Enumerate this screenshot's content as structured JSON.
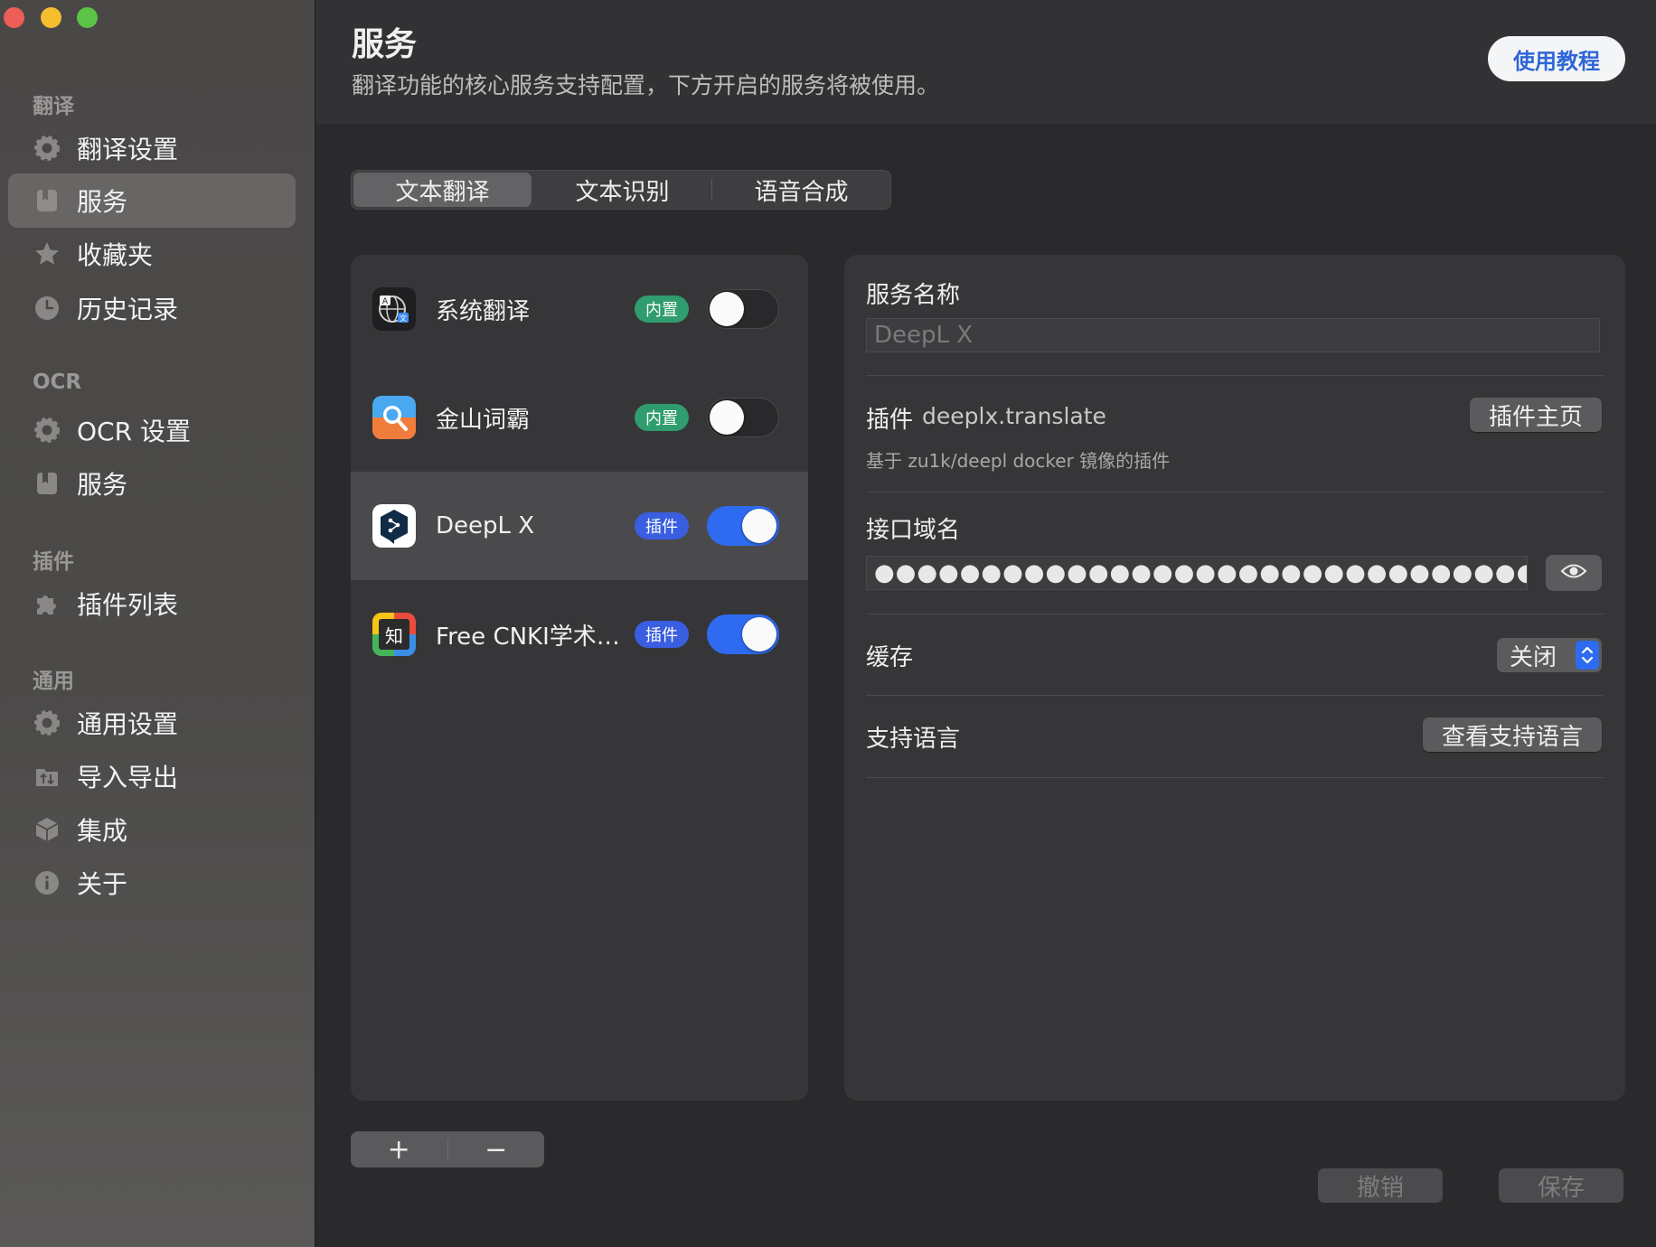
{
  "window": {
    "controls": [
      "close",
      "minimize",
      "zoom"
    ]
  },
  "sidebar": {
    "sections": [
      {
        "title": "翻译",
        "items": [
          {
            "label": "翻译设置",
            "icon": "gear-icon",
            "active": false
          },
          {
            "label": "服务",
            "icon": "bookmark-icon",
            "active": true
          },
          {
            "label": "收藏夹",
            "icon": "star-icon",
            "active": false
          },
          {
            "label": "历史记录",
            "icon": "clock-icon",
            "active": false
          }
        ]
      },
      {
        "title": "OCR",
        "items": [
          {
            "label": "OCR 设置",
            "icon": "gear-icon",
            "active": false
          },
          {
            "label": "服务",
            "icon": "bookmark-icon",
            "active": false
          }
        ]
      },
      {
        "title": "插件",
        "items": [
          {
            "label": "插件列表",
            "icon": "puzzle-icon",
            "active": false
          }
        ]
      },
      {
        "title": "通用",
        "items": [
          {
            "label": "通用设置",
            "icon": "gear-icon",
            "active": false
          },
          {
            "label": "导入导出",
            "icon": "folder-transfer-icon",
            "active": false
          },
          {
            "label": "集成",
            "icon": "cube-icon",
            "active": false
          },
          {
            "label": "关于",
            "icon": "info-icon",
            "active": false
          }
        ]
      }
    ]
  },
  "header": {
    "title": "服务",
    "subtitle": "翻译功能的核心服务支持配置，下方开启的服务将被使用。",
    "tutorial_label": "使用教程"
  },
  "tabs": [
    {
      "label": "文本翻译",
      "active": true
    },
    {
      "label": "文本识别",
      "active": false
    },
    {
      "label": "语音合成",
      "active": false
    }
  ],
  "services": [
    {
      "name": "系统翻译",
      "badge": "内置",
      "badge_type": "builtin",
      "enabled": false,
      "selected": false,
      "icon": "system-translate-icon"
    },
    {
      "name": "金山词霸",
      "badge": "内置",
      "badge_type": "builtin",
      "enabled": false,
      "selected": false,
      "icon": "iciba-icon"
    },
    {
      "name": "DeepL X",
      "badge": "插件",
      "badge_type": "plugin",
      "enabled": true,
      "selected": true,
      "icon": "deepl-icon"
    },
    {
      "name": "Free CNKI学术…",
      "badge": "插件",
      "badge_type": "plugin",
      "enabled": true,
      "selected": false,
      "icon": "cnki-icon"
    }
  ],
  "list_controls": {
    "add": "+",
    "remove": "−"
  },
  "detail": {
    "service_name_label": "服务名称",
    "service_name_placeholder": "DeepL X",
    "plugin_label": "插件",
    "plugin_id": "deeplx.translate",
    "plugin_homepage_button": "插件主页",
    "plugin_description": "基于 zu1k/deepl docker 镜像的插件",
    "api_domain_label": "接口域名",
    "api_domain_masked": "●●●●●●●●●●●●●●●●●●●●●●●●●●●●●●●●●●●●●●",
    "cache_label": "缓存",
    "cache_value": "关闭",
    "languages_label": "支持语言",
    "languages_button": "查看支持语言"
  },
  "footer": {
    "cancel_label": "撤销",
    "save_label": "保存"
  },
  "colors": {
    "accent": "#2f6bf0",
    "builtin_badge": "#2f9d6d",
    "plugin_badge": "#3a5ee0",
    "close": "#ee5d58",
    "minimize": "#f5be2f",
    "zoom": "#5bc345"
  }
}
